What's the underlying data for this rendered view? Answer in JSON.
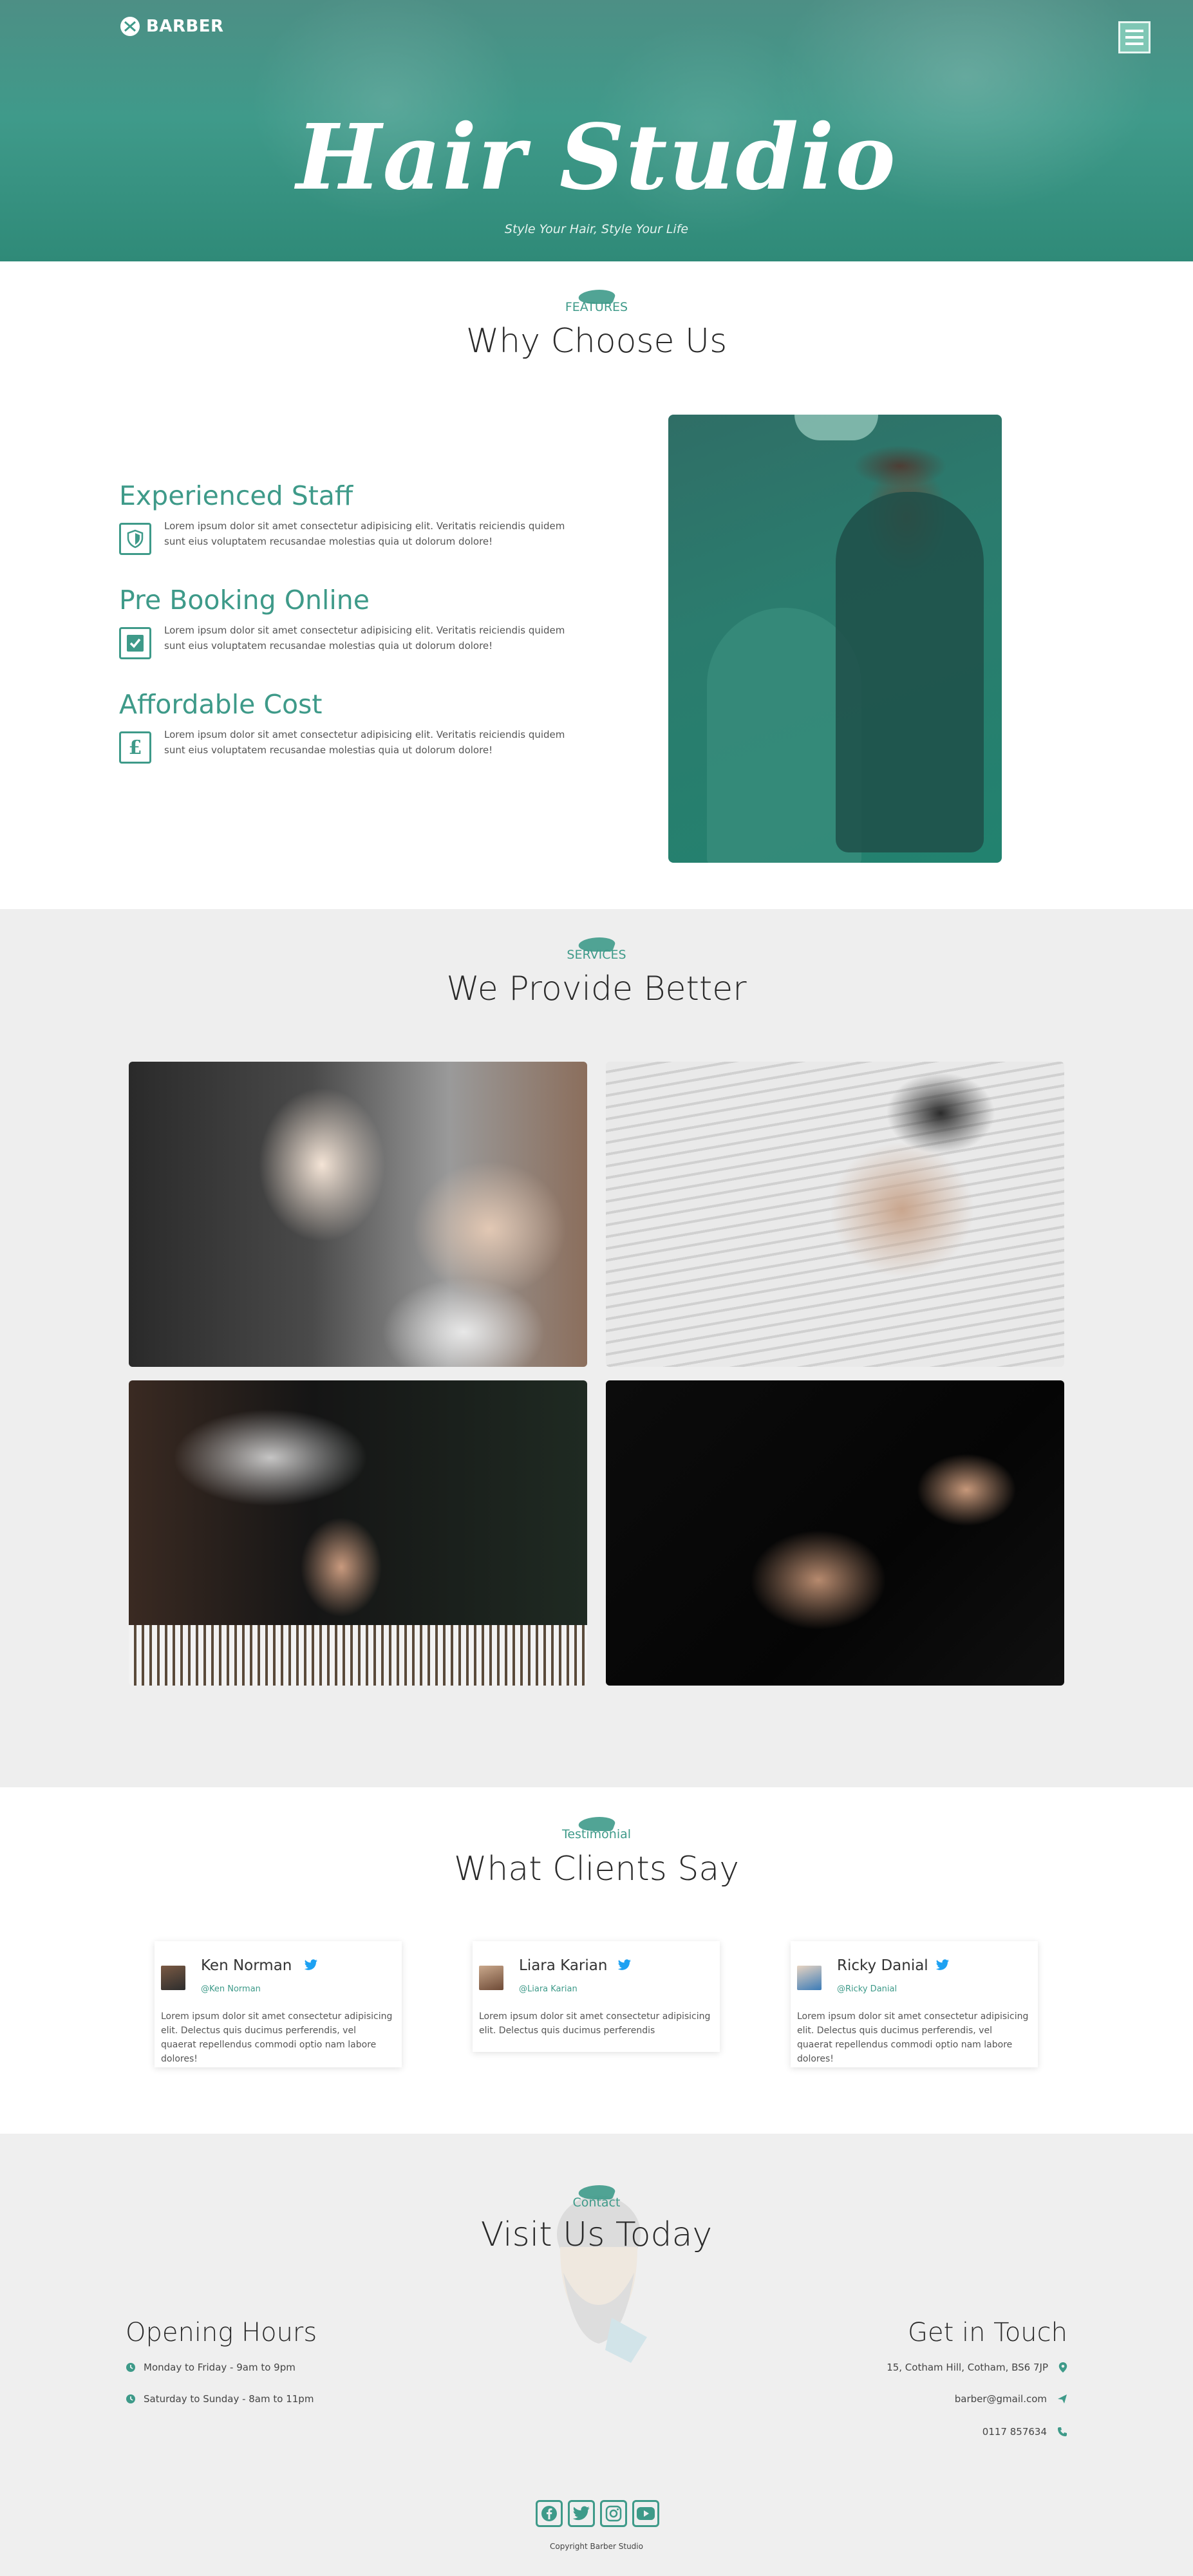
{
  "header": {
    "logo_text": "BARBER",
    "title": "Hair Studio",
    "subtitle": "Style Your Hair, Style Your Life"
  },
  "features": {
    "tag": "FEATURES",
    "title": "Why Choose Us",
    "items": [
      {
        "title": "Experienced Staff",
        "text": "Lorem ipsum dolor sit amet consectetur adipisicing elit. Veritatis reiciendis quidem sunt eius voluptatem recusandae molestias quia ut dolorum dolore!",
        "icon": "shield-icon"
      },
      {
        "title": "Pre Booking Online",
        "text": "Lorem ipsum dolor sit amet consectetur adipisicing elit. Veritatis reiciendis quidem sunt eius voluptatem recusandae molestias quia ut dolorum dolore!",
        "icon": "checkbox-icon"
      },
      {
        "title": "Affordable Cost",
        "text": "Lorem ipsum dolor sit amet consectetur adipisicing elit. Veritatis reiciendis quidem sunt eius voluptatem recusandae molestias quia ut dolorum dolore!",
        "icon": "pound-icon"
      }
    ]
  },
  "services": {
    "tag": "SERVICES",
    "title": "We Provide Better"
  },
  "testimonials": {
    "tag": "Testimonial",
    "title": "What Clients Say",
    "items": [
      {
        "name": "Ken Norman",
        "handle": "@Ken Norman",
        "quote": "Lorem ipsum dolor sit amet consectetur adipisicing elit. Delectus quis ducimus perferendis, vel quaerat repellendus commodi optio nam labore dolores!"
      },
      {
        "name": "Liara Karian",
        "handle": "@Liara Karian",
        "quote": "Lorem ipsum dolor sit amet consectetur adipisicing elit. Delectus quis ducimus perferendis"
      },
      {
        "name": "Ricky Danial",
        "handle": "@Ricky Danial",
        "quote": "Lorem ipsum dolor sit amet consectetur adipisicing elit. Delectus quis ducimus perferendis, vel quaerat repellendus commodi optio nam labore dolores!"
      }
    ]
  },
  "contact": {
    "tag": "Contact",
    "title": "Visit Us Today",
    "hours_title": "Opening Hours",
    "hours": [
      "Monday to Friday - 9am to 9pm",
      "Saturday to Sunday - 8am to 11pm"
    ],
    "touch_title": "Get in Touch",
    "address": "15, Cotham Hill, Cotham, BS6 7JP",
    "email": "barber@gmail.com",
    "phone": "0117 857634"
  },
  "footer": {
    "copyright": "Copyright Barber Studio"
  },
  "colors": {
    "accent": "#3e9a89",
    "twitter": "#1da1f2"
  }
}
